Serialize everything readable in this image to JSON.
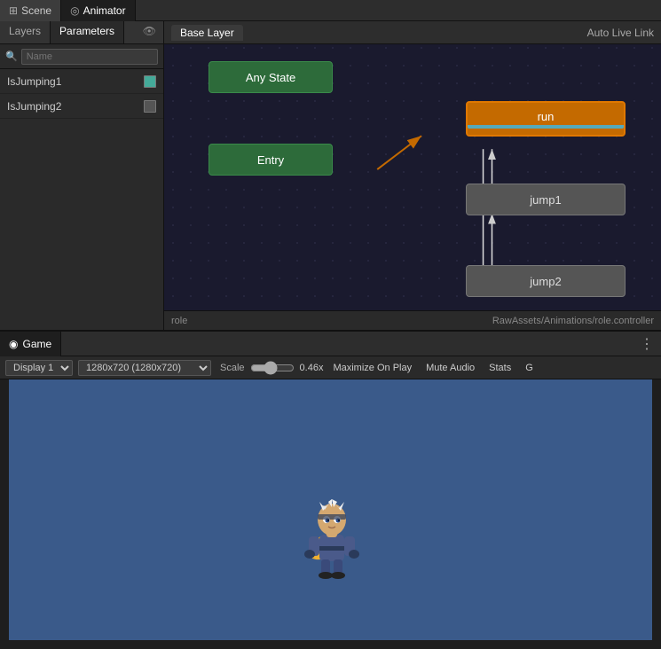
{
  "tabs": [
    {
      "id": "scene",
      "label": "Scene",
      "icon": "⊞",
      "active": false
    },
    {
      "id": "animator",
      "label": "Animator",
      "icon": "◎",
      "active": true
    }
  ],
  "left_panel": {
    "tabs": [
      {
        "id": "layers",
        "label": "Layers",
        "active": false
      },
      {
        "id": "parameters",
        "label": "Parameters",
        "active": true
      }
    ],
    "search_placeholder": "Name",
    "add_button_label": "+",
    "parameters": [
      {
        "name": "IsJumping1",
        "checked": true
      },
      {
        "name": "IsJumping2",
        "checked": false
      }
    ]
  },
  "animator": {
    "base_layer_label": "Base Layer",
    "auto_live_link_label": "Auto Live Link",
    "nodes": {
      "any_state": "Any State",
      "entry": "Entry",
      "run": "run",
      "jump1": "jump1",
      "jump2": "jump2"
    },
    "status": {
      "left": "role",
      "right": "RawAssets/Animations/role.controller"
    }
  },
  "game": {
    "tab_label": "Game",
    "tab_icon": "◉",
    "options_icon": "⋮",
    "toolbar": {
      "display_label": "Display 1",
      "resolution_label": "1280x720 (1280x720)",
      "scale_label": "Scale",
      "scale_value": "0.46x",
      "maximize_label": "Maximize On Play",
      "mute_label": "Mute Audio",
      "stats_label": "Stats",
      "gizmos_label": "G"
    }
  }
}
